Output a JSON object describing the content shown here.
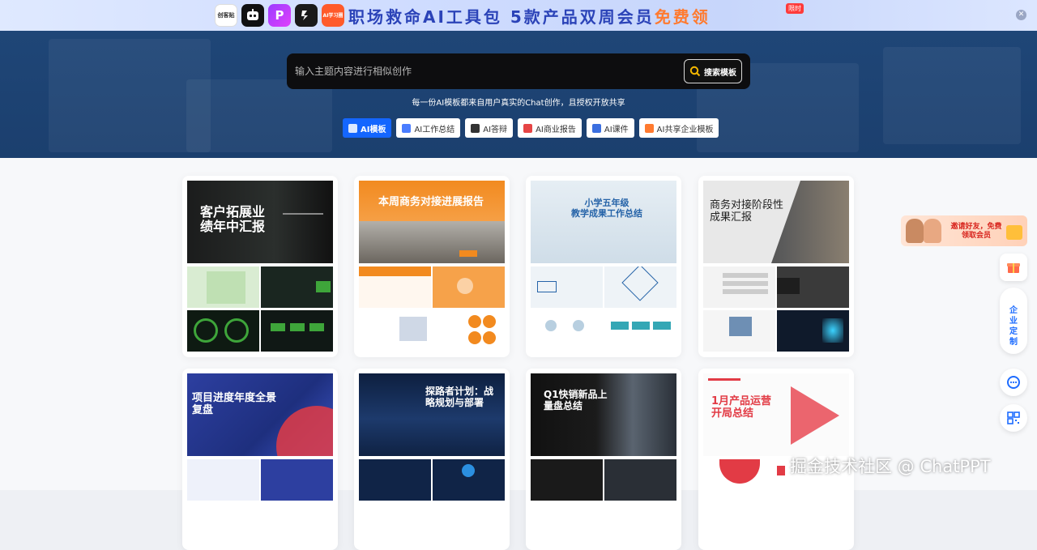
{
  "promo": {
    "text_main": "职场救命AI工具包 5款产品双周会员",
    "text_free": "免费领",
    "badge": "限时",
    "icons": [
      {
        "name": "app-icon-1",
        "label": "创客贴",
        "color": "#ffffff"
      },
      {
        "name": "robot-icon",
        "label": "",
        "color": "#111111"
      },
      {
        "name": "app-icon-p",
        "label": "P",
        "color": "#8a2be2"
      },
      {
        "name": "app-icon-s",
        "label": "",
        "color": "#1a1a1a"
      },
      {
        "name": "app-icon-ai",
        "label": "AI学习圈",
        "color": "#ff5a2a"
      }
    ]
  },
  "search": {
    "placeholder": "输入主题内容进行相似创作",
    "button_label": "搜索模板"
  },
  "tagline": "每一份AI模板都来自用户真实的Chat创作，且授权开放共享",
  "categories": [
    {
      "label": "AI模板",
      "active": true,
      "icon_color": "#ffffff"
    },
    {
      "label": "AI工作总结",
      "active": false,
      "icon_color": "#4a7dff"
    },
    {
      "label": "AI答辩",
      "active": false,
      "icon_color": "#333333"
    },
    {
      "label": "AI商业报告",
      "active": false,
      "icon_color": "#e64545"
    },
    {
      "label": "AI课件",
      "active": false,
      "icon_color": "#3b6fe0"
    },
    {
      "label": "AI共享企业模板",
      "active": false,
      "icon_color": "#ff7a2f"
    }
  ],
  "templates": [
    {
      "title": "客户拓展业\n绩年中汇报",
      "theme": "dark-green"
    },
    {
      "title": "本周商务对接进展报告",
      "theme": "orange"
    },
    {
      "title": "小学五年级\n教学成果工作总结",
      "theme": "light-blue"
    },
    {
      "title": "商务对接阶段性\n成果汇报",
      "theme": "gray"
    },
    {
      "title": "项目进度年度全景\n复盘",
      "theme": "blue-red"
    },
    {
      "title": "探路者计划：战\n略规划与部署",
      "theme": "navy"
    },
    {
      "title": "Q1快销新品上\n量盘总结",
      "theme": "dark-building"
    },
    {
      "title": "1月产品运营\n开局总结",
      "theme": "red-white"
    }
  ],
  "side": {
    "invite_text": "邀请好友，免费领取会员",
    "enterprise_label": "企业定制"
  },
  "watermark": "掘金技术社区 @ ChatPPT",
  "colors": {
    "hero": "#1f4677",
    "accent": "#1466ff",
    "promo": "#2b43b8"
  }
}
